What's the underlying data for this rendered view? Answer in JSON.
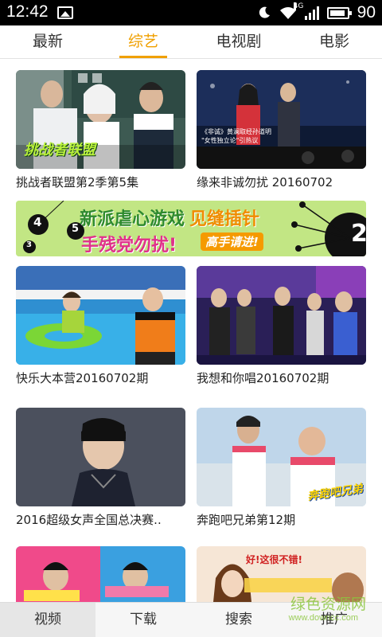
{
  "status_bar": {
    "time": "12:42",
    "battery": "90",
    "network": "4G"
  },
  "tabs": [
    {
      "label": "最新",
      "active": false
    },
    {
      "label": "综艺",
      "active": true
    },
    {
      "label": "电视剧",
      "active": false
    },
    {
      "label": "电影",
      "active": false
    }
  ],
  "videos": [
    {
      "title": "挑战者联盟第2季第5集",
      "overlay": "挑战者联盟"
    },
    {
      "title": "缘来非诚勿扰 20160702",
      "overlay": "《非诚》黄澜取经孙道明\n\"女性独立论\"引热议"
    },
    {
      "title": "快乐大本营20160702期"
    },
    {
      "title": "我想和你唱20160702期"
    },
    {
      "title": "2016超级女声全国总决赛.."
    },
    {
      "title": "奔跑吧兄弟第12期",
      "overlay": "奔跑吧兄弟"
    },
    {
      "title": ""
    },
    {
      "title": "",
      "overlay": "好!这很不错!"
    }
  ],
  "banner": {
    "line1": "新派虐心游戏",
    "highlight": "见缝插针",
    "line2": "手残党勿扰!",
    "button": "高手请进!",
    "numbers": [
      "4",
      "5",
      "3",
      "2"
    ]
  },
  "bottom_nav": [
    {
      "label": "视频",
      "active": true
    },
    {
      "label": "下载",
      "active": false
    },
    {
      "label": "搜索",
      "active": false
    },
    {
      "label": "推广",
      "active": false
    }
  ],
  "watermark": {
    "text": "绿色资源网",
    "url": "www.downcc.com"
  }
}
